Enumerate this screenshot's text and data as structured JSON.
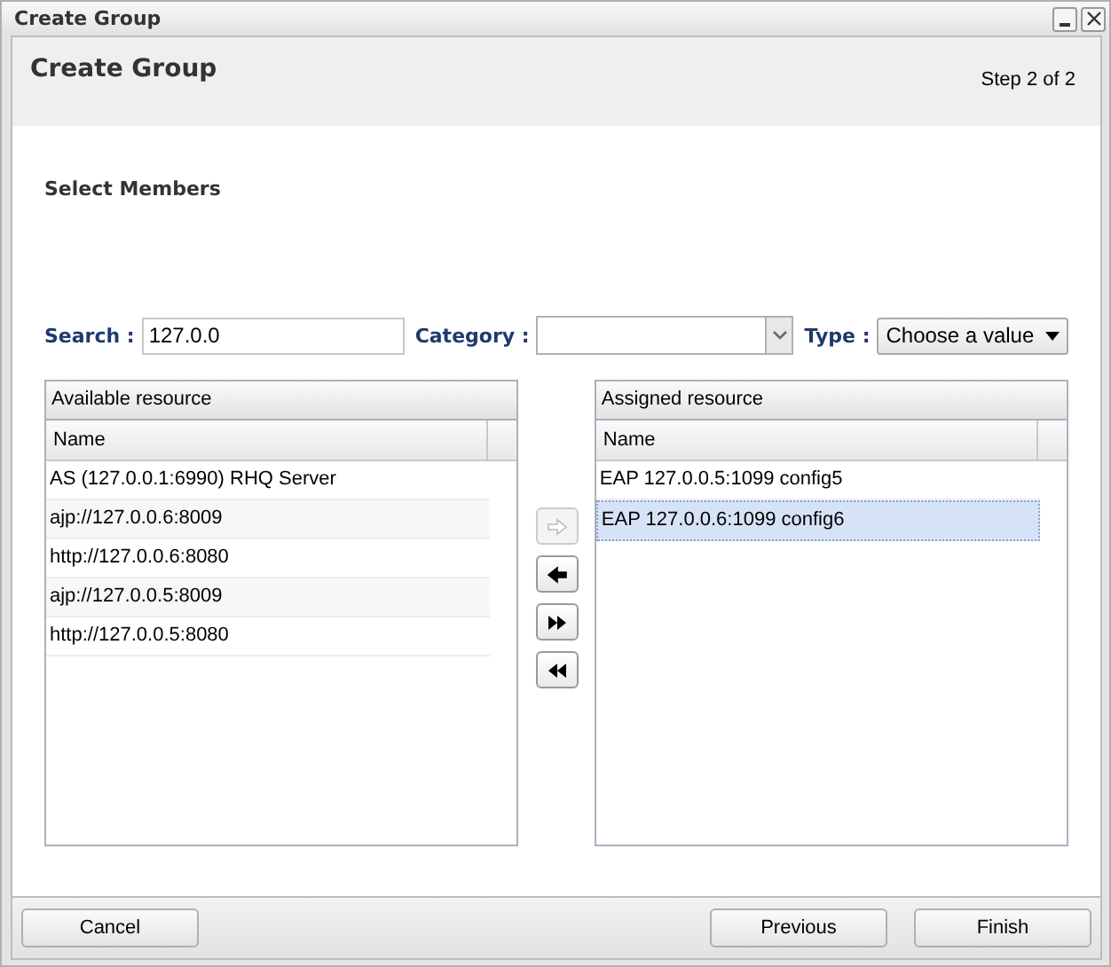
{
  "window": {
    "title": "Create Group"
  },
  "header": {
    "title": "Create Group",
    "step": "Step 2 of 2"
  },
  "section_title": "Select Members",
  "filters": {
    "search": {
      "label": "Search :",
      "value": "127.0.0"
    },
    "category": {
      "label": "Category :"
    },
    "type": {
      "label": "Type :",
      "value": "Choose a value"
    }
  },
  "available": {
    "title": "Available resource",
    "column": "Name",
    "rows": [
      {
        "name": "AS (127.0.0.1:6990) RHQ Server",
        "selected": false
      },
      {
        "name": "ajp://127.0.0.6:8009",
        "selected": false
      },
      {
        "name": "http://127.0.0.6:8080",
        "selected": false
      },
      {
        "name": "ajp://127.0.0.5:8009",
        "selected": false
      },
      {
        "name": "http://127.0.0.5:8080",
        "selected": false
      }
    ]
  },
  "move_buttons": [
    {
      "kind": "add",
      "disabled": true
    },
    {
      "kind": "remove",
      "disabled": false
    },
    {
      "kind": "add-all",
      "disabled": false
    },
    {
      "kind": "remove-all",
      "disabled": false
    }
  ],
  "assigned": {
    "title": "Assigned resource",
    "column": "Name",
    "rows": [
      {
        "name": "EAP 127.0.0.5:1099 config5",
        "selected": false
      },
      {
        "name": "EAP 127.0.0.6:1099 config6",
        "selected": true
      }
    ]
  },
  "footer": {
    "buttons": [
      "Cancel",
      "Previous",
      "Finish"
    ]
  }
}
